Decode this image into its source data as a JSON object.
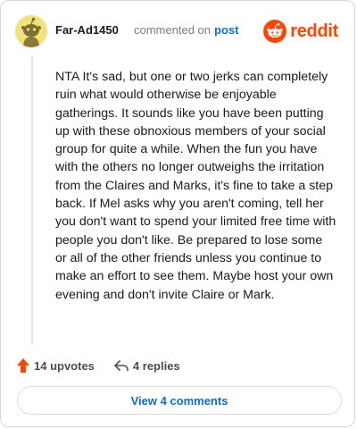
{
  "comment": {
    "author": "Far-Ad1450",
    "meta_text": "commented on",
    "post_link": "post",
    "brand": "reddit",
    "body": "NTA It's sad, but one or two jerks can completely ruin what would otherwise be enjoyable gatherings. It sounds like you have been putting up with these obnoxious members of your social group for quite a while. When the fun you have with the others no longer outweighs the irritation from the Claires and Marks, it's fine to take a step back. If Mel asks why you aren't coming, tell her you don't want to spend your limited free time with people you don't like. Be prepared to lose some or all of the other friends unless you continue to make an effort to see them. Maybe host your own evening and don't invite Claire or Mark.",
    "upvotes": "14 upvotes",
    "replies": "4 replies",
    "view_comments": "View 4 comments"
  },
  "icons": {
    "avatar": "snoo-avatar-icon",
    "logo": "reddit-logo-icon",
    "upvote": "upvote-arrow-icon",
    "reply": "reply-arrow-icon"
  },
  "colors": {
    "brand": "#ff4500",
    "link": "#0a6cd6",
    "avatar_bg": "#f2e27a"
  }
}
